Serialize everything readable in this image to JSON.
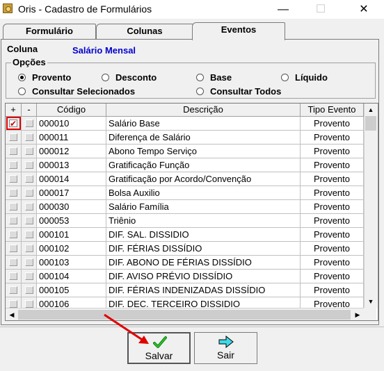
{
  "window": {
    "title": "Oris - Cadastro de Formulários",
    "minimize": "—",
    "maximize": "☐",
    "close": "✕"
  },
  "tabs": [
    {
      "label": "Formulário",
      "active": false
    },
    {
      "label": "Colunas",
      "active": false
    },
    {
      "label": "Eventos",
      "active": true
    }
  ],
  "coluna": {
    "label": "Coluna",
    "value": "Salário Mensal"
  },
  "opcoes": {
    "legend": "Opções",
    "options": [
      {
        "label": "Provento",
        "selected": true
      },
      {
        "label": "Desconto",
        "selected": false
      },
      {
        "label": "Base",
        "selected": false
      },
      {
        "label": "Líquido",
        "selected": false
      },
      {
        "label": "Consultar Selecionados",
        "selected": false
      },
      {
        "label": "Consultar Todos",
        "selected": false
      }
    ]
  },
  "grid": {
    "headers": {
      "plus": "+",
      "minus": "-",
      "codigo": "Código",
      "descricao": "Descrição",
      "tipo": "Tipo Evento"
    },
    "rows": [
      {
        "checked": true,
        "codigo": "000010",
        "descricao": "Salário Base",
        "tipo": "Provento"
      },
      {
        "checked": false,
        "codigo": "000011",
        "descricao": "Diferença de Salário",
        "tipo": "Provento"
      },
      {
        "checked": false,
        "codigo": "000012",
        "descricao": "Abono Tempo Serviço",
        "tipo": "Provento"
      },
      {
        "checked": false,
        "codigo": "000013",
        "descricao": "Gratificação Função",
        "tipo": "Provento"
      },
      {
        "checked": false,
        "codigo": "000014",
        "descricao": "Gratificação por Acordo/Convenção",
        "tipo": "Provento"
      },
      {
        "checked": false,
        "codigo": "000017",
        "descricao": "Bolsa Auxilio",
        "tipo": "Provento"
      },
      {
        "checked": false,
        "codigo": "000030",
        "descricao": "Salário Família",
        "tipo": "Provento"
      },
      {
        "checked": false,
        "codigo": "000053",
        "descricao": "Triênio",
        "tipo": "Provento"
      },
      {
        "checked": false,
        "codigo": "000101",
        "descricao": "DIF. SAL. DISSIDIO",
        "tipo": "Provento"
      },
      {
        "checked": false,
        "codigo": "000102",
        "descricao": "DIF. FÉRIAS DISSÍDIO",
        "tipo": "Provento"
      },
      {
        "checked": false,
        "codigo": "000103",
        "descricao": "DIF. ABONO DE FÉRIAS DISSÍDIO",
        "tipo": "Provento"
      },
      {
        "checked": false,
        "codigo": "000104",
        "descricao": "DIF. AVISO PRÉVIO DISSÍDIO",
        "tipo": "Provento"
      },
      {
        "checked": false,
        "codigo": "000105",
        "descricao": "DIF. FÉRIAS INDENIZADAS DISSÍDIO",
        "tipo": "Provento"
      },
      {
        "checked": false,
        "codigo": "000106",
        "descricao": "DIF. DEC. TERCEIRO DISSIDIO",
        "tipo": "Provento"
      }
    ]
  },
  "buttons": {
    "salvar": {
      "label": "Salvar",
      "icon": "green-check-icon"
    },
    "sair": {
      "label": "Sair",
      "icon": "cyan-arrow-right-icon"
    }
  },
  "colors": {
    "accent_blue": "#0000cc",
    "highlight_red": "#e00000"
  }
}
